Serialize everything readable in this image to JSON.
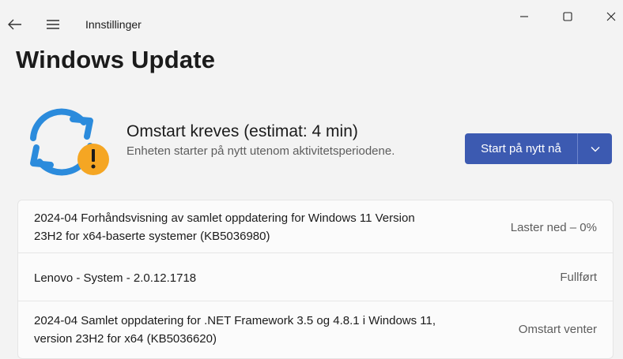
{
  "window": {
    "app_title": "Innstillinger"
  },
  "page": {
    "title": "Windows Update"
  },
  "status": {
    "title": "Omstart kreves (estimat: 4 min)",
    "subtitle": "Enheten starter på nytt utenom aktivitetsperiodene.",
    "icon": "update-sync-warning-icon",
    "accent_blue": "#2b8bdc",
    "warning_orange": "#f5a623"
  },
  "actions": {
    "restart_label": "Start på nytt nå",
    "restart_color": "#3c5ab1"
  },
  "updates": [
    {
      "name_line1": "2024-04 Forhåndsvisning av samlet oppdatering for Windows 11 Version",
      "name_line2": "23H2 for x64-baserte systemer (KB5036980)",
      "status": "Laster ned – 0%"
    },
    {
      "name_line1": "Lenovo - System - 2.0.12.1718",
      "name_line2": "",
      "status": "Fullført"
    },
    {
      "name_line1": "2024-04 Samlet oppdatering for .NET Framework 3.5 og 4.8.1 i Windows 11,",
      "name_line2": "version 23H2 for x64 (KB5036620)",
      "status": "Omstart venter"
    }
  ]
}
